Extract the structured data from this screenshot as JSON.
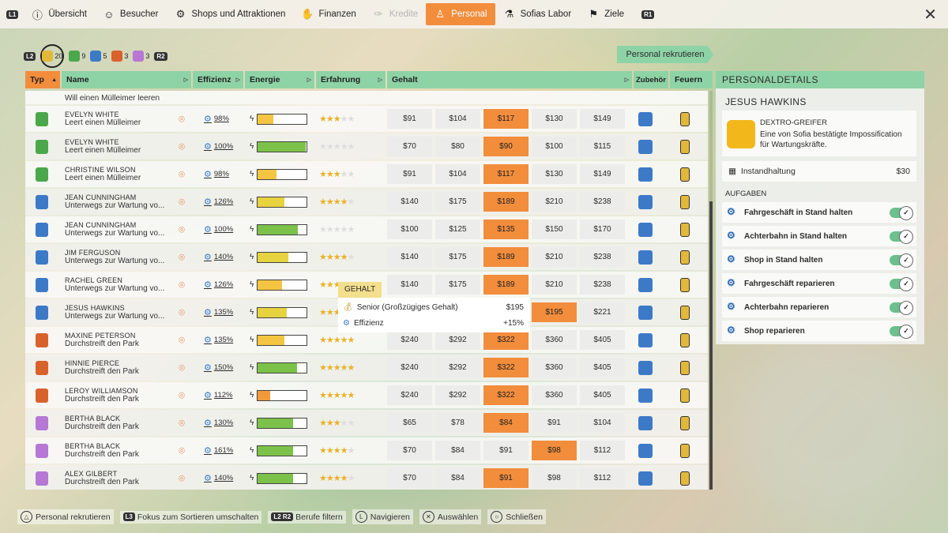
{
  "nav": {
    "l1": "L1",
    "r1": "R1",
    "items": [
      {
        "label": "Übersicht",
        "icon": "ⓘ",
        "icon_name": "info-icon",
        "state": "normal"
      },
      {
        "label": "Besucher",
        "icon": "☺",
        "icon_name": "visitors-icon",
        "state": "normal"
      },
      {
        "label": "Shops und Attraktionen",
        "icon": "⚙",
        "icon_name": "shops-icon",
        "state": "normal"
      },
      {
        "label": "Finanzen",
        "icon": "✋",
        "icon_name": "finance-icon",
        "state": "normal"
      },
      {
        "label": "Kredite",
        "icon": "✑",
        "icon_name": "credits-icon",
        "state": "disabled"
      },
      {
        "label": "Personal",
        "icon": "♙",
        "icon_name": "staff-icon",
        "state": "active"
      },
      {
        "label": "Sofias Labor",
        "icon": "⚗",
        "icon_name": "lab-icon",
        "state": "normal"
      },
      {
        "label": "Ziele",
        "icon": "⚑",
        "icon_name": "goals-icon",
        "state": "normal"
      }
    ],
    "close_icon": "✕"
  },
  "filters": {
    "l2": "L2",
    "r2": "R2",
    "chips": [
      {
        "count": "20",
        "color": "#e2b83a",
        "selected": true
      },
      {
        "count": "9",
        "color": "#4aa84b",
        "selected": false
      },
      {
        "count": "5",
        "color": "#3c7ac8",
        "selected": false
      },
      {
        "count": "3",
        "color": "#d9612a",
        "selected": false
      },
      {
        "count": "3",
        "color": "#b678d4",
        "selected": false
      }
    ]
  },
  "recruit_button": "Personal rekrutieren",
  "columns": {
    "typ": "Typ",
    "name": "Name",
    "effizienz": "Effizienz",
    "energie": "Energie",
    "erfahrung": "Erfahrung",
    "gehalt": "Gehalt",
    "zubehoer": "Zubehör",
    "feuern": "Feuern"
  },
  "partial_row_text": "Will einen Mülleimer leeren",
  "rows": [
    {
      "name": "EVELYN WHITE",
      "activity": "Leert einen Mülleimer",
      "type_color": "#4aa84b",
      "efficiency": "98%",
      "energy": 0.32,
      "energy_color": "#f5c542",
      "stars": 3,
      "salaries": [
        "$91",
        "$104",
        "$117",
        "$130",
        "$149"
      ],
      "hl": 2
    },
    {
      "name": "EVELYN WHITE",
      "activity": "Leert einen Mülleimer",
      "type_color": "#4aa84b",
      "efficiency": "100%",
      "energy": 0.98,
      "energy_color": "#7cc24a",
      "stars": 0,
      "salaries": [
        "$70",
        "$80",
        "$90",
        "$100",
        "$115"
      ],
      "hl": 2
    },
    {
      "name": "CHRISTINE WILSON",
      "activity": "Leert einen Mülleimer",
      "type_color": "#4aa84b",
      "efficiency": "98%",
      "energy": 0.38,
      "energy_color": "#f5c542",
      "stars": 3,
      "salaries": [
        "$91",
        "$104",
        "$117",
        "$130",
        "$149"
      ],
      "hl": 2
    },
    {
      "name": "JEAN CUNNINGHAM",
      "activity": "Unterwegs zur Wartung vo...",
      "type_color": "#3c7ac8",
      "efficiency": "126%",
      "energy": 0.55,
      "energy_color": "#e7d23f",
      "stars": 4,
      "salaries": [
        "$140",
        "$175",
        "$189",
        "$210",
        "$238"
      ],
      "hl": 2
    },
    {
      "name": "JEAN CUNNINGHAM",
      "activity": "Unterwegs zur Wartung vo...",
      "type_color": "#3c7ac8",
      "efficiency": "100%",
      "energy": 0.82,
      "energy_color": "#7cc24a",
      "stars": 0,
      "salaries": [
        "$100",
        "$125",
        "$135",
        "$150",
        "$170"
      ],
      "hl": 2
    },
    {
      "name": "JIM FERGUSON",
      "activity": "Unterwegs zur Wartung vo...",
      "type_color": "#3c7ac8",
      "efficiency": "140%",
      "energy": 0.62,
      "energy_color": "#e7d23f",
      "stars": 4,
      "salaries": [
        "$140",
        "$175",
        "$189",
        "$210",
        "$238"
      ],
      "hl": 2
    },
    {
      "name": "RACHEL GREEN",
      "activity": "Unterwegs zur Wartung vo...",
      "type_color": "#3c7ac8",
      "efficiency": "126%",
      "energy": 0.5,
      "energy_color": "#f5c542",
      "stars": 3,
      "salaries": [
        "$140",
        "$175",
        "$189",
        "$210",
        "$238"
      ],
      "hl": 2
    },
    {
      "name": "JESUS HAWKINS",
      "activity": "Unterwegs zur Wartung vo...",
      "type_color": "#3c7ac8",
      "efficiency": "135%",
      "energy": 0.6,
      "energy_color": "#e7d23f",
      "stars": 4,
      "salaries": [
        "",
        "",
        "",
        "$195",
        "$221"
      ],
      "hl": 3
    },
    {
      "name": "MAXINE PETERSON",
      "activity": "Durchstreift den Park",
      "type_color": "#d9612a",
      "efficiency": "135%",
      "energy": 0.55,
      "energy_color": "#f5c542",
      "stars": 5,
      "salaries": [
        "$240",
        "$292",
        "$322",
        "$360",
        "$405"
      ],
      "hl": 2
    },
    {
      "name": "HINNIE PIERCE",
      "activity": "Durchstreift den Park",
      "type_color": "#d9612a",
      "efficiency": "150%",
      "energy": 0.8,
      "energy_color": "#7cc24a",
      "stars": 5,
      "salaries": [
        "$240",
        "$292",
        "$322",
        "$360",
        "$405"
      ],
      "hl": 2
    },
    {
      "name": "LEROY WILLIAMSON",
      "activity": "Durchstreift den Park",
      "type_color": "#d9612a",
      "efficiency": "112%",
      "energy": 0.25,
      "energy_color": "#f29a3a",
      "stars": 5,
      "salaries": [
        "$240",
        "$292",
        "$322",
        "$360",
        "$405"
      ],
      "hl": 2
    },
    {
      "name": "BERTHA BLACK",
      "activity": "Durchstreift den Park",
      "type_color": "#b678d4",
      "efficiency": "130%",
      "energy": 0.72,
      "energy_color": "#7cc24a",
      "stars": 3,
      "salaries": [
        "$65",
        "$78",
        "$84",
        "$91",
        "$104"
      ],
      "hl": 2
    },
    {
      "name": "BERTHA BLACK",
      "activity": "Durchstreift den Park",
      "type_color": "#b678d4",
      "efficiency": "161%",
      "energy": 0.72,
      "energy_color": "#7cc24a",
      "stars": 4,
      "salaries": [
        "$70",
        "$84",
        "$91",
        "$98",
        "$112"
      ],
      "hl": 3
    },
    {
      "name": "ALEX GILBERT",
      "activity": "Durchstreift den Park",
      "type_color": "#b678d4",
      "efficiency": "140%",
      "energy": 0.72,
      "energy_color": "#7cc24a",
      "stars": 4,
      "salaries": [
        "$70",
        "$84",
        "$91",
        "$98",
        "$112"
      ],
      "hl": 2
    }
  ],
  "tooltip": {
    "title": "GEHALT",
    "line1_label": "Senior (Großzügiges Gehalt)",
    "line1_value": "$195",
    "line2_label": "Effizienz",
    "line2_value": "+15%"
  },
  "panel": {
    "title": "PERSONALDETAILS",
    "name": "JESUS HAWKINS",
    "item_title": "DEXTRO-GREIFER",
    "item_desc": "Eine von Sofia bestätigte Impossification für Wartungskräfte.",
    "maint_label": "Instandhaltung",
    "maint_value": "$30",
    "tasks_label": "AUFGABEN",
    "tasks": [
      "Fahrgeschäft in Stand halten",
      "Achterbahn in Stand halten",
      "Shop in Stand halten",
      "Fahrgeschäft reparieren",
      "Achterbahn reparieren",
      "Shop reparieren"
    ]
  },
  "hints": [
    {
      "glyph": "△",
      "label": "Personal rekrutieren"
    },
    {
      "glyph": "L3",
      "label": "Fokus zum Sortieren umschalten"
    },
    {
      "glyph": "L2 R2",
      "label": "Berufe filtern"
    },
    {
      "glyph": "L",
      "label": "Navigieren"
    },
    {
      "glyph": "✕",
      "label": "Auswählen"
    },
    {
      "glyph": "○",
      "label": "Schließen"
    }
  ]
}
